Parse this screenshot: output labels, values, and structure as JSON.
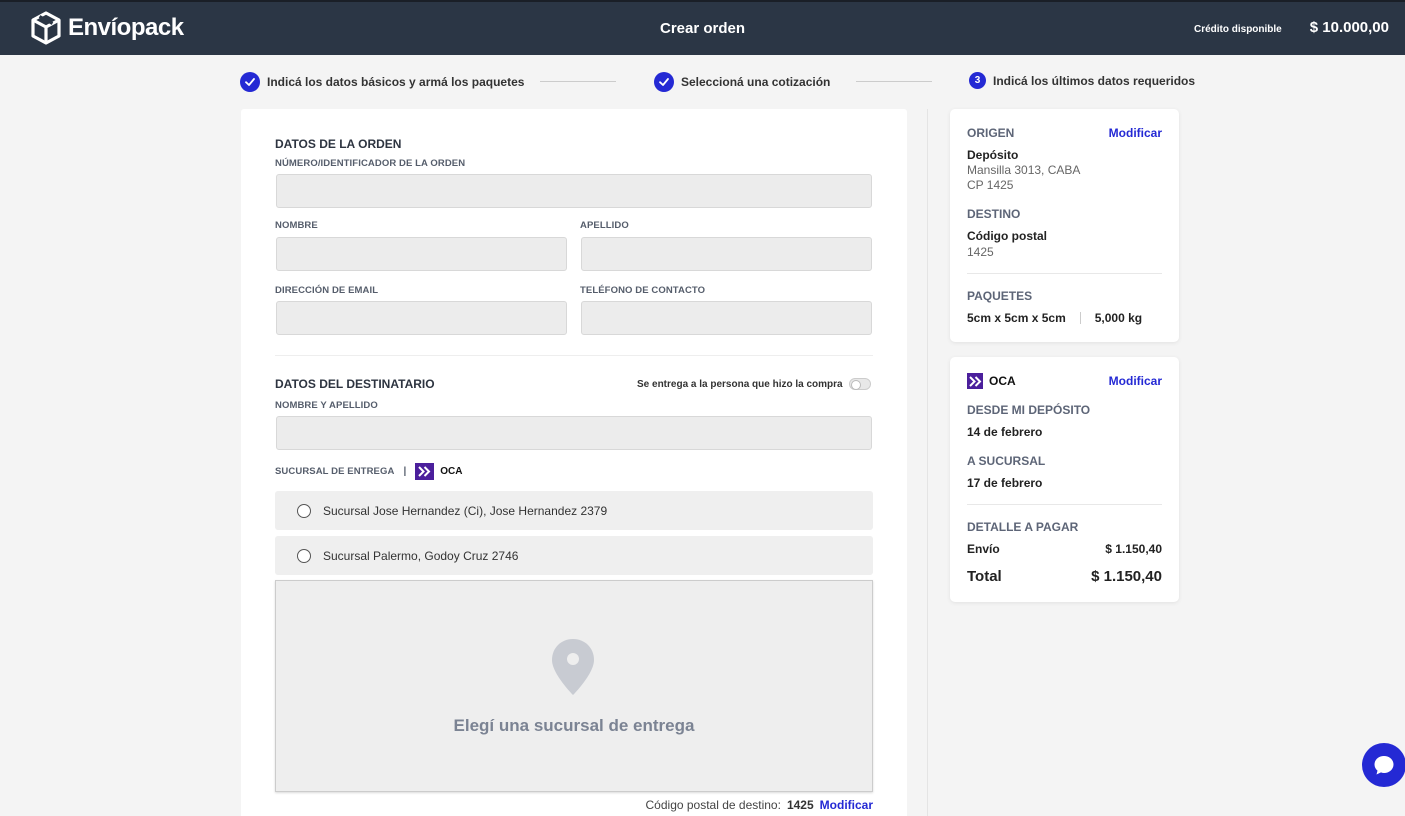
{
  "header": {
    "brand": "Envíopack",
    "title": "Crear orden",
    "credit_label": "Crédito disponible",
    "credit_value": "$ 10.000,00"
  },
  "steps": [
    {
      "label": "Indicá los datos básicos y armá los paquetes",
      "state": "done"
    },
    {
      "label": "Seleccioná una cotización",
      "state": "done"
    },
    {
      "label": "Indicá los últimos datos requeridos",
      "state": "current",
      "number": "3"
    }
  ],
  "order": {
    "section_title": "DATOS DE LA ORDEN",
    "id_label": "NÚMERO/IDENTIFICADOR DE LA ORDEN",
    "id_value": "",
    "first_name_label": "NOMBRE",
    "first_name_value": "",
    "last_name_label": "APELLIDO",
    "last_name_value": "",
    "email_label": "DIRECCIÓN DE EMAIL",
    "email_value": "",
    "phone_label": "TELÉFONO DE CONTACTO",
    "phone_value": ""
  },
  "recipient": {
    "section_title": "DATOS DEL DESTINATARIO",
    "same_buyer_label": "Se entrega a la persona que hizo la compra",
    "same_buyer_on": false,
    "name_label": "NOMBRE Y APELLIDO",
    "name_value": "",
    "branch_label": "SUCURSAL DE ENTREGA",
    "branch_separator": "|",
    "carrier": "OCA",
    "branches": [
      {
        "label": "Sucursal Jose Hernandez (Ci), Jose Hernandez 2379",
        "selected": false
      },
      {
        "label": "Sucursal Palermo, Godoy Cruz 2746",
        "selected": false
      }
    ],
    "map_placeholder": "Elegí una sucursal de entrega",
    "postal_label": "Código postal de destino:",
    "postal_value": "1425",
    "postal_modify": "Modificar"
  },
  "summary": {
    "origin_head": "ORIGEN",
    "origin_modify": "Modificar",
    "origin_name": "Depósito",
    "origin_address": "Mansilla 3013, CABA",
    "origin_cp": "CP 1425",
    "dest_head": "DESTINO",
    "dest_name": "Código postal",
    "dest_value": "1425",
    "packages_head": "PAQUETES",
    "package_dims": "5cm x 5cm x 5cm",
    "package_weight": "5,000 kg"
  },
  "quote": {
    "carrier": "OCA",
    "modify": "Modificar",
    "from_head": "DESDE MI DEPÓSITO",
    "from_date": "14 de febrero",
    "to_head": "A SUCURSAL",
    "to_date": "17 de febrero",
    "detail_head": "DETALLE A PAGAR",
    "shipping_label": "Envío",
    "shipping_value": "$ 1.150,40",
    "total_label": "Total",
    "total_value": "$ 1.150,40"
  },
  "colors": {
    "accent": "#2429d4",
    "header_bg": "#2b3645",
    "oca_brand": "#4b1f9c"
  },
  "icons": {
    "brand": "box-logo-icon",
    "step_done": "check-icon",
    "carrier": "oca-chevrons-icon",
    "map": "map-pin-icon",
    "chat": "chat-bubble-icon"
  }
}
